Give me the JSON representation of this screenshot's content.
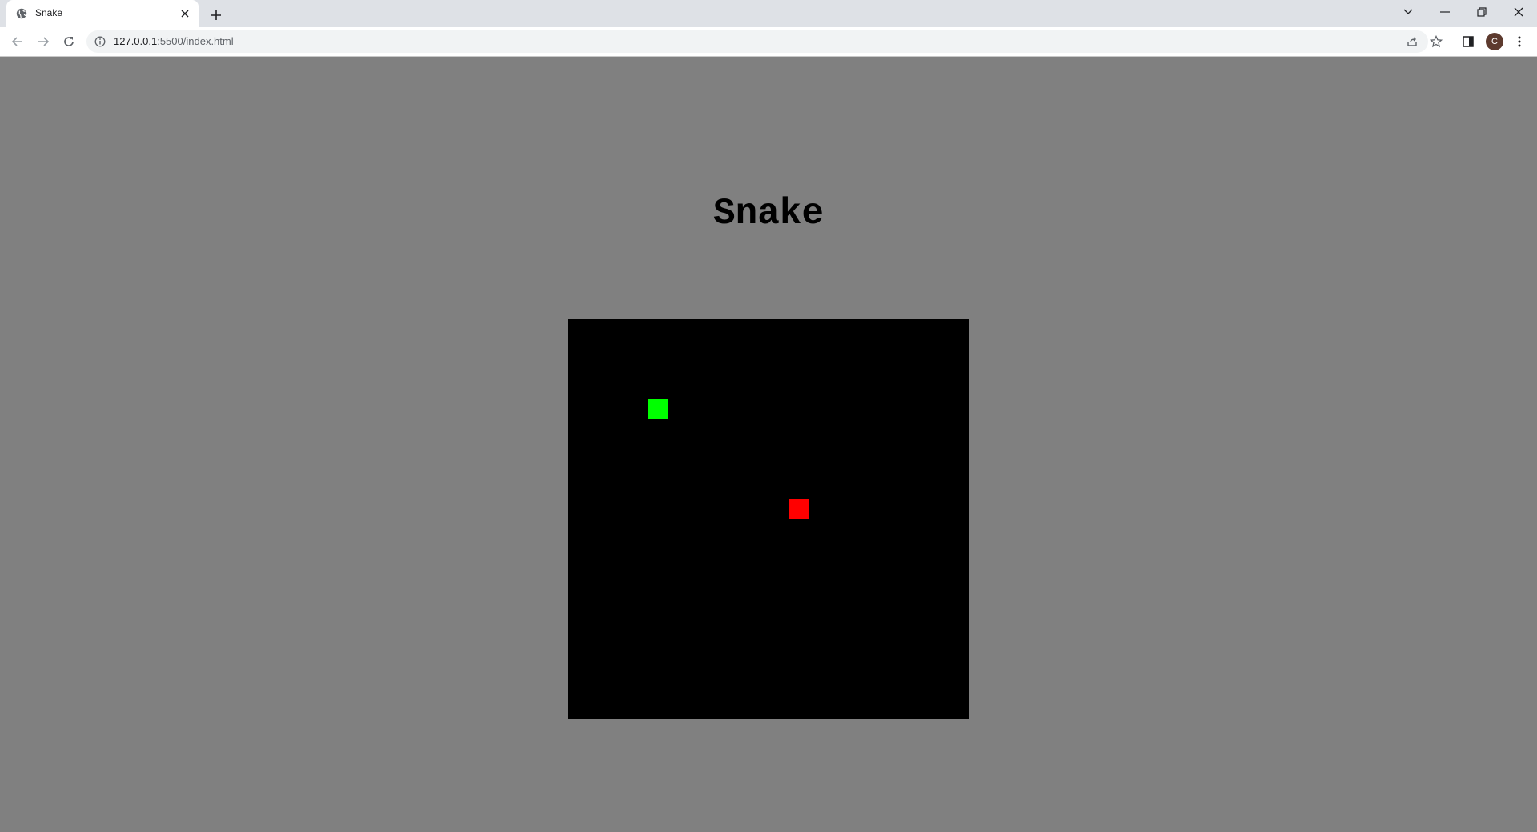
{
  "browser": {
    "tab_title": "Snake",
    "url_host": "127.0.0.1",
    "url_path": ":5500/index.html",
    "avatar_initial": "C"
  },
  "page": {
    "title": "Snake",
    "background_color": "#808080"
  },
  "game": {
    "board_color": "#000000",
    "grid_columns": 20,
    "grid_rows": 20,
    "snake_color": "#00ff00",
    "food_color": "#ff0000",
    "snake": [
      {
        "col": 4,
        "row": 4
      }
    ],
    "food": {
      "col": 11,
      "row": 9
    }
  }
}
